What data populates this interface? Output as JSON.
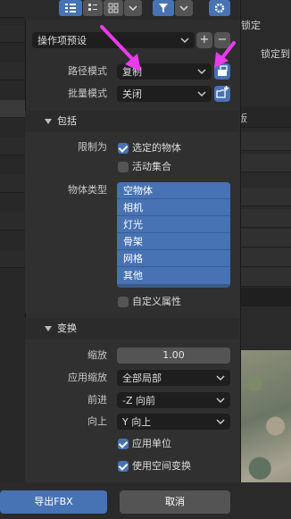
{
  "background": {
    "right_panel_text_1": "锁定",
    "right_panel_text_2": "锁定到",
    "right_panel_text_3": "版"
  },
  "toolbar": {
    "filter_icon": "funnel-icon",
    "settings_icon": "gear-icon"
  },
  "presets": {
    "label": "操作项预设",
    "add_label": "+",
    "remove_label": "−"
  },
  "path_mode": {
    "label": "路径模式",
    "value": "复制"
  },
  "batch_mode": {
    "label": "批量模式",
    "value": "关闭"
  },
  "include": {
    "header": "包括",
    "limit_label": "限制为",
    "selected_objects": "选定的物体",
    "active_collection": "活动集合",
    "object_types_label": "物体类型",
    "object_types": [
      "空物体",
      "相机",
      "灯光",
      "骨架",
      "网格",
      "其他"
    ],
    "custom_props": "自定义属性"
  },
  "transform": {
    "header": "变换",
    "scale_label": "缩放",
    "scale_value": "1.00",
    "apply_scale_label": "应用缩放",
    "apply_scale_value": "全部局部",
    "forward_label": "前进",
    "forward_value": "-Z 向前",
    "up_label": "向上",
    "up_value": "Y 向上",
    "apply_unit": "应用单位",
    "use_space_transform": "使用空间变换"
  },
  "footer": {
    "export_label": "导出FBX",
    "cancel_label": "取消"
  },
  "colors": {
    "accent": "#4772b3",
    "annotation_arrow": "#e83ce8"
  }
}
